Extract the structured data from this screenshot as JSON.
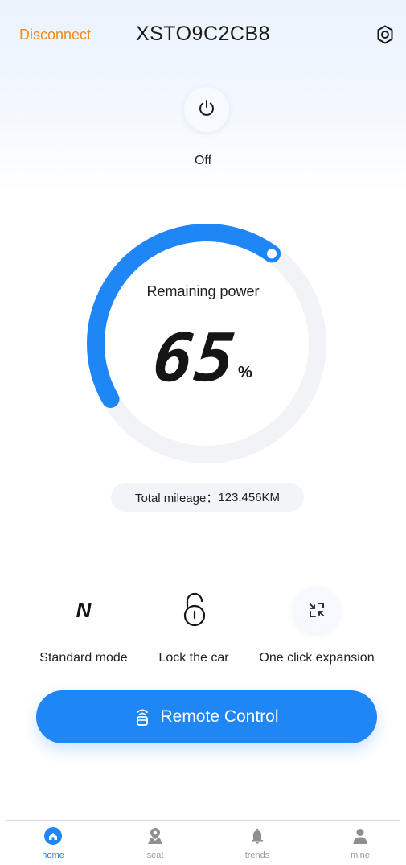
{
  "header": {
    "disconnect_label": "Disconnect",
    "device_id": "XSTO9C2CB8",
    "settings_icon": "gear-icon"
  },
  "power": {
    "icon": "power-icon",
    "state_label": "Off"
  },
  "battery": {
    "label": "Remaining power",
    "value": "65",
    "unit": "%",
    "level_fraction": 0.65,
    "accent_color": "#1f86f5"
  },
  "mileage": {
    "label": "Total mileage：",
    "value": "123.456KM"
  },
  "actions": [
    {
      "label": "Standard mode",
      "icon_glyph": "N",
      "icon": "drive-mode-icon"
    },
    {
      "label": "Lock the car",
      "icon": "lock-icon"
    },
    {
      "label": "One click expansion",
      "icon": "expand-icon"
    }
  ],
  "remote": {
    "label": "Remote Control",
    "icon": "remote-key-icon"
  },
  "tabs": [
    {
      "label": "home",
      "icon": "home-icon",
      "active": true
    },
    {
      "label": "seat",
      "icon": "location-icon",
      "active": false
    },
    {
      "label": "trends",
      "icon": "bell-icon",
      "active": false
    },
    {
      "label": "mine",
      "icon": "user-icon",
      "active": false
    }
  ],
  "colors": {
    "accent": "#1f86f5",
    "warning": "#f08a1c",
    "inactive": "#9a9a9a"
  }
}
